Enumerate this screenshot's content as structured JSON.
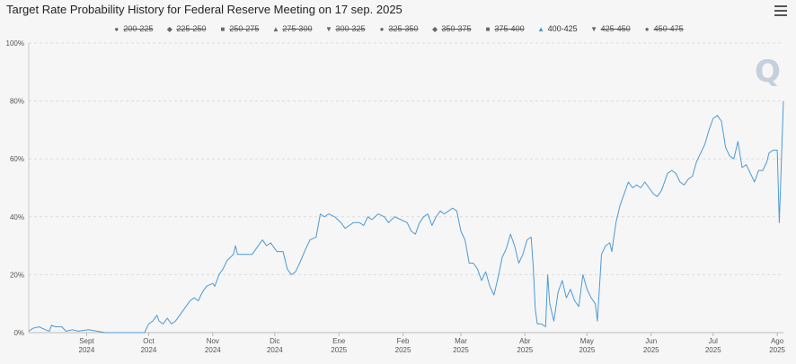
{
  "title": "Target Rate Probability History for Federal Reserve Meeting on 17 sep. 2025",
  "menu_icon": "hamburger-icon",
  "logo_text": "Q",
  "legend": [
    {
      "label": "200-225",
      "symbol": "●",
      "visible": false
    },
    {
      "label": "225-250",
      "symbol": "◆",
      "visible": false
    },
    {
      "label": "250-275",
      "symbol": "■",
      "visible": false
    },
    {
      "label": "275-300",
      "symbol": "▲",
      "visible": false
    },
    {
      "label": "300-325",
      "symbol": "▼",
      "visible": false
    },
    {
      "label": "325-350",
      "symbol": "●",
      "visible": false
    },
    {
      "label": "350-375",
      "symbol": "◆",
      "visible": false
    },
    {
      "label": "375-400",
      "symbol": "■",
      "visible": false
    },
    {
      "label": "400-425",
      "symbol": "▲",
      "visible": true
    },
    {
      "label": "425-450",
      "symbol": "▼",
      "visible": false
    },
    {
      "label": "450-475",
      "symbol": "●",
      "visible": false
    }
  ],
  "chart_data": {
    "type": "line",
    "title": "Target Rate Probability History for Federal Reserve Meeting on 17 sep. 2025",
    "x_range": [
      "2024-08-04",
      "2025-08-04"
    ],
    "ylim": [
      0,
      100
    ],
    "y_ticks": [
      "0%",
      "20%",
      "40%",
      "60%",
      "80%",
      "100%"
    ],
    "x_ticks": [
      {
        "date": "2024-09-01",
        "line1": "Sept",
        "line2": "2024"
      },
      {
        "date": "2024-10-01",
        "line1": "Oct",
        "line2": "2024"
      },
      {
        "date": "2024-11-01",
        "line1": "Nov",
        "line2": "2024"
      },
      {
        "date": "2024-12-01",
        "line1": "Dic",
        "line2": "2024"
      },
      {
        "date": "2025-01-01",
        "line1": "Ene",
        "line2": "2025"
      },
      {
        "date": "2025-02-01",
        "line1": "Feb",
        "line2": "2025"
      },
      {
        "date": "2025-03-01",
        "line1": "Mar",
        "line2": "2025"
      },
      {
        "date": "2025-04-01",
        "line1": "Abr",
        "line2": "2025"
      },
      {
        "date": "2025-05-01",
        "line1": "May",
        "line2": "2025"
      },
      {
        "date": "2025-06-01",
        "line1": "Jun",
        "line2": "2025"
      },
      {
        "date": "2025-07-01",
        "line1": "Jul",
        "line2": "2025"
      },
      {
        "date": "2025-08-01",
        "line1": "Ago",
        "line2": "2025"
      }
    ],
    "grid": "horizontal-dashed",
    "legend_position": "top-center",
    "series": [
      {
        "name": "400-425",
        "color": "#4d9ad3",
        "points": [
          [
            "2024-08-04",
            0.5
          ],
          [
            "2024-08-06",
            1.5
          ],
          [
            "2024-08-09",
            2
          ],
          [
            "2024-08-12",
            1
          ],
          [
            "2024-08-14",
            0.5
          ],
          [
            "2024-08-15",
            2.5
          ],
          [
            "2024-08-17",
            2
          ],
          [
            "2024-08-20",
            2
          ],
          [
            "2024-08-22",
            0.5
          ],
          [
            "2024-08-25",
            1
          ],
          [
            "2024-08-28",
            0.5
          ],
          [
            "2024-09-02",
            1
          ],
          [
            "2024-09-06",
            0.5
          ],
          [
            "2024-09-10",
            0
          ],
          [
            "2024-09-20",
            0
          ],
          [
            "2024-09-29",
            0
          ],
          [
            "2024-10-01",
            3
          ],
          [
            "2024-10-03",
            4
          ],
          [
            "2024-10-05",
            6
          ],
          [
            "2024-10-06",
            4
          ],
          [
            "2024-10-08",
            3
          ],
          [
            "2024-10-10",
            5
          ],
          [
            "2024-10-12",
            3
          ],
          [
            "2024-10-14",
            4
          ],
          [
            "2024-10-17",
            7
          ],
          [
            "2024-10-19",
            9
          ],
          [
            "2024-10-21",
            11
          ],
          [
            "2024-10-23",
            12
          ],
          [
            "2024-10-25",
            11
          ],
          [
            "2024-10-27",
            14
          ],
          [
            "2024-10-29",
            16
          ],
          [
            "2024-11-01",
            17
          ],
          [
            "2024-11-02",
            16
          ],
          [
            "2024-11-04",
            20
          ],
          [
            "2024-11-06",
            22
          ],
          [
            "2024-11-08",
            25
          ],
          [
            "2024-11-11",
            27
          ],
          [
            "2024-11-12",
            30
          ],
          [
            "2024-11-13",
            27
          ],
          [
            "2024-11-16",
            27
          ],
          [
            "2024-11-20",
            27
          ],
          [
            "2024-11-22",
            29
          ],
          [
            "2024-11-25",
            32
          ],
          [
            "2024-11-27",
            30
          ],
          [
            "2024-11-29",
            31
          ],
          [
            "2024-12-02",
            28
          ],
          [
            "2024-12-05",
            28
          ],
          [
            "2024-12-07",
            22
          ],
          [
            "2024-12-09",
            20
          ],
          [
            "2024-12-11",
            21
          ],
          [
            "2024-12-13",
            24
          ],
          [
            "2024-12-16",
            29
          ],
          [
            "2024-12-18",
            32
          ],
          [
            "2024-12-21",
            33
          ],
          [
            "2024-12-23",
            41
          ],
          [
            "2024-12-25",
            40
          ],
          [
            "2024-12-27",
            41
          ],
          [
            "2024-12-30",
            40
          ],
          [
            "2025-01-02",
            38
          ],
          [
            "2025-01-04",
            36
          ],
          [
            "2025-01-06",
            37
          ],
          [
            "2025-01-08",
            38
          ],
          [
            "2025-01-11",
            38
          ],
          [
            "2025-01-13",
            37
          ],
          [
            "2025-01-15",
            40
          ],
          [
            "2025-01-17",
            39
          ],
          [
            "2025-01-20",
            41
          ],
          [
            "2025-01-23",
            40
          ],
          [
            "2025-01-25",
            38
          ],
          [
            "2025-01-28",
            40
          ],
          [
            "2025-01-31",
            39
          ],
          [
            "2025-02-03",
            38
          ],
          [
            "2025-02-05",
            35
          ],
          [
            "2025-02-07",
            34
          ],
          [
            "2025-02-09",
            38
          ],
          [
            "2025-02-11",
            40
          ],
          [
            "2025-02-13",
            41
          ],
          [
            "2025-02-15",
            37
          ],
          [
            "2025-02-17",
            40
          ],
          [
            "2025-02-19",
            42
          ],
          [
            "2025-02-21",
            41
          ],
          [
            "2025-02-23",
            42
          ],
          [
            "2025-02-25",
            43
          ],
          [
            "2025-02-27",
            42
          ],
          [
            "2025-03-01",
            35
          ],
          [
            "2025-03-03",
            32
          ],
          [
            "2025-03-05",
            24
          ],
          [
            "2025-03-07",
            24
          ],
          [
            "2025-03-09",
            22
          ],
          [
            "2025-03-11",
            18
          ],
          [
            "2025-03-13",
            21
          ],
          [
            "2025-03-15",
            16
          ],
          [
            "2025-03-17",
            13
          ],
          [
            "2025-03-19",
            19
          ],
          [
            "2025-03-21",
            26
          ],
          [
            "2025-03-23",
            29
          ],
          [
            "2025-03-25",
            34
          ],
          [
            "2025-03-27",
            30
          ],
          [
            "2025-03-29",
            24
          ],
          [
            "2025-03-31",
            27
          ],
          [
            "2025-04-02",
            32
          ],
          [
            "2025-04-04",
            33
          ],
          [
            "2025-04-05",
            23
          ],
          [
            "2025-04-06",
            8
          ],
          [
            "2025-04-07",
            3
          ],
          [
            "2025-04-09",
            3
          ],
          [
            "2025-04-11",
            2
          ],
          [
            "2025-04-12",
            20
          ],
          [
            "2025-04-13",
            10
          ],
          [
            "2025-04-15",
            4
          ],
          [
            "2025-04-17",
            14
          ],
          [
            "2025-04-19",
            18
          ],
          [
            "2025-04-21",
            12
          ],
          [
            "2025-04-23",
            15
          ],
          [
            "2025-04-25",
            11
          ],
          [
            "2025-04-27",
            9
          ],
          [
            "2025-04-29",
            20
          ],
          [
            "2025-05-01",
            15
          ],
          [
            "2025-05-03",
            12
          ],
          [
            "2025-05-05",
            10
          ],
          [
            "2025-05-06",
            4
          ],
          [
            "2025-05-08",
            27
          ],
          [
            "2025-05-10",
            30
          ],
          [
            "2025-05-12",
            31
          ],
          [
            "2025-05-13",
            28
          ],
          [
            "2025-05-15",
            38
          ],
          [
            "2025-05-17",
            44
          ],
          [
            "2025-05-19",
            48
          ],
          [
            "2025-05-21",
            52
          ],
          [
            "2025-05-23",
            50
          ],
          [
            "2025-05-25",
            51
          ],
          [
            "2025-05-27",
            50
          ],
          [
            "2025-05-29",
            52
          ],
          [
            "2025-05-31",
            50
          ],
          [
            "2025-06-02",
            48
          ],
          [
            "2025-06-04",
            47
          ],
          [
            "2025-06-06",
            49
          ],
          [
            "2025-06-09",
            55
          ],
          [
            "2025-06-11",
            56
          ],
          [
            "2025-06-13",
            55
          ],
          [
            "2025-06-15",
            52
          ],
          [
            "2025-06-17",
            51
          ],
          [
            "2025-06-19",
            53
          ],
          [
            "2025-06-21",
            54
          ],
          [
            "2025-06-23",
            59
          ],
          [
            "2025-06-25",
            62
          ],
          [
            "2025-06-27",
            65
          ],
          [
            "2025-06-29",
            70
          ],
          [
            "2025-07-01",
            74
          ],
          [
            "2025-07-03",
            75
          ],
          [
            "2025-07-05",
            73
          ],
          [
            "2025-07-07",
            64
          ],
          [
            "2025-07-09",
            61
          ],
          [
            "2025-07-11",
            60
          ],
          [
            "2025-07-13",
            66
          ],
          [
            "2025-07-15",
            57
          ],
          [
            "2025-07-17",
            58
          ],
          [
            "2025-07-19",
            55
          ],
          [
            "2025-07-21",
            52
          ],
          [
            "2025-07-23",
            56
          ],
          [
            "2025-07-25",
            56
          ],
          [
            "2025-07-27",
            59
          ],
          [
            "2025-07-28",
            62
          ],
          [
            "2025-07-30",
            63
          ],
          [
            "2025-08-01",
            63
          ],
          [
            "2025-08-02",
            38
          ],
          [
            "2025-08-04",
            80
          ]
        ]
      }
    ]
  }
}
